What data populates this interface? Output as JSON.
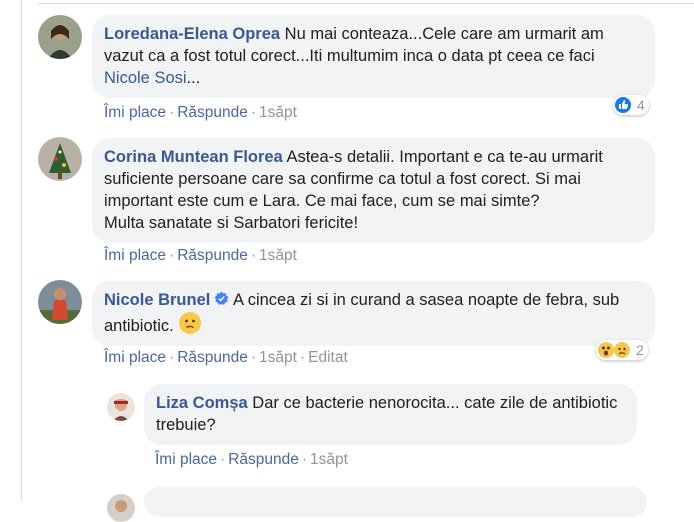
{
  "comments": [
    {
      "author": "Loredana-Elena Oprea",
      "text": " Nu mai conteaza...Cele care am urmarit am vazut ca a fost totul corect...Iti multumim inca o data pt ceea ce faci ",
      "tag": "Nicole Sosi",
      "tag_suffix": "...",
      "like_label": "Îmi place",
      "reply_label": "Răspunde",
      "time": "1săpt",
      "reaction_count": "4",
      "reaction_icons": [
        "like-icon"
      ]
    },
    {
      "author": "Corina Muntean Florea",
      "text": " Astea-s detalii. Important e ca te-au urmarit suficiente persoane care sa confirme ca totul a fost corect. Si mai important este cum e Lara. Ce mai face, cum se mai simte?\nMulta sanatate si Sarbatori fericite!",
      "like_label": "Îmi place",
      "reply_label": "Răspunde",
      "time": "1săpt"
    },
    {
      "author": "Nicole Brunel",
      "text": " A cincea zi si in curand a sasea noapte de febra, sub antibiotic.",
      "like_label": "Îmi place",
      "reply_label": "Răspunde",
      "time": "1săpt",
      "edited_label": "Editat",
      "reaction_count": "2",
      "reaction_icons": [
        "wow-icon",
        "sad-icon"
      ],
      "emoji": "worried-face-icon",
      "badge": "verified-badge-icon"
    },
    {
      "author": "Liza Comșa",
      "text": " Dar ce bacterie nenorocita... cate zile de antibiotic trebuie?",
      "like_label": "Îmi place",
      "reply_label": "Răspunde",
      "time": "1săpt"
    }
  ],
  "colors": {
    "link": "#385898",
    "meta": "#90949c",
    "bubble": "#f2f3f5",
    "like_reaction": "#1877f2"
  }
}
